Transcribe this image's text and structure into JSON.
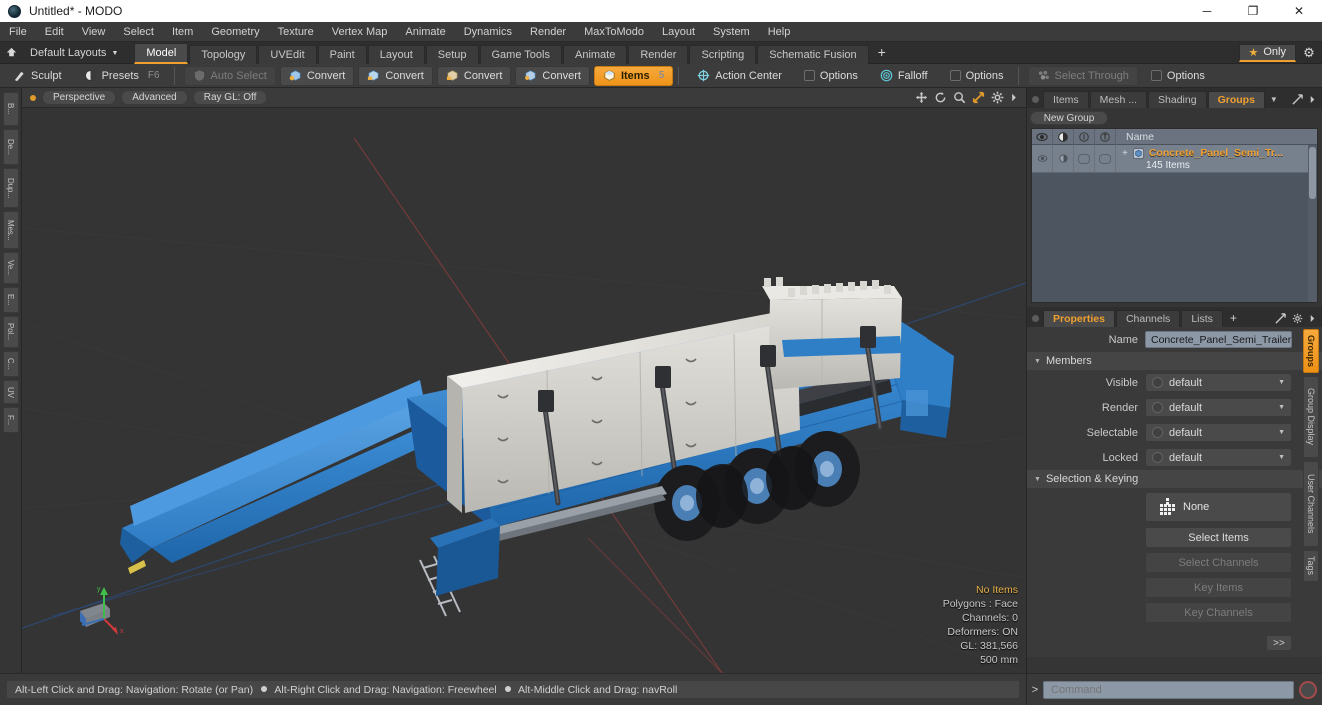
{
  "window": {
    "title": "Untitled* - MODO",
    "app_icon": "modo-sphere-icon",
    "minimize": "─",
    "maximize": "❐",
    "close": "✕"
  },
  "menubar": {
    "items": [
      "File",
      "Edit",
      "View",
      "Select",
      "Item",
      "Geometry",
      "Texture",
      "Vertex Map",
      "Animate",
      "Dynamics",
      "Render",
      "MaxToModo",
      "Layout",
      "System",
      "Help"
    ]
  },
  "layoutbar": {
    "home_icon": "home-layout-icon",
    "layout_selector": "Default Layouts",
    "caret": "▼",
    "tabs": [
      {
        "label": "Model",
        "active": true
      },
      {
        "label": "Topology",
        "active": false
      },
      {
        "label": "UVEdit",
        "active": false
      },
      {
        "label": "Paint",
        "active": false
      },
      {
        "label": "Layout",
        "active": false
      },
      {
        "label": "Setup",
        "active": false
      },
      {
        "label": "Game Tools",
        "active": false
      },
      {
        "label": "Animate",
        "active": false
      },
      {
        "label": "Render",
        "active": false
      },
      {
        "label": "Scripting",
        "active": false
      },
      {
        "label": "Schematic Fusion",
        "active": false
      }
    ],
    "add_tab": "+",
    "only_label": "Only",
    "only_star": "★",
    "gear": "⚙",
    "accent": "#f0a030"
  },
  "toolbar": {
    "items": [
      {
        "label": "Sculpt",
        "icon": "sculpt-brush-icon",
        "state": "flat"
      },
      {
        "label": "Presets",
        "icon": "presets-sphere-icon",
        "state": "flat",
        "shortcut": "F6"
      },
      {
        "label": "Auto Select",
        "icon": "auto-select-icon",
        "state": "disabled"
      },
      {
        "label": "Convert",
        "icon": "convert-vertex-icon",
        "state": "normal"
      },
      {
        "label": "Convert",
        "icon": "convert-edge-icon",
        "state": "normal"
      },
      {
        "label": "Convert",
        "icon": "convert-polygon-icon",
        "state": "normal"
      },
      {
        "label": "Convert",
        "icon": "convert-item-icon",
        "state": "normal"
      },
      {
        "label": "Items",
        "icon": "items-cube-icon",
        "state": "active",
        "shortcut": "5"
      },
      {
        "label": "Action Center",
        "icon": "action-center-icon",
        "state": "flat"
      },
      {
        "label": "Options",
        "icon": "checkbox-icon",
        "state": "flat"
      },
      {
        "label": "Falloff",
        "icon": "falloff-icon",
        "state": "flat"
      },
      {
        "label": "Options",
        "icon": "checkbox-icon",
        "state": "flat"
      },
      {
        "label": "Select Through",
        "icon": "select-through-icon",
        "state": "disabled"
      },
      {
        "label": "Options",
        "icon": "checkbox-icon",
        "state": "flat"
      }
    ]
  },
  "left_tabs": [
    "B...",
    "De...",
    "Dup...",
    "Mes...",
    "Ve...",
    "E...",
    "Pol...",
    "C...",
    "UV",
    "F..."
  ],
  "viewport": {
    "dot": "viewport-active-dot",
    "buttons": [
      "Perspective",
      "Advanced",
      "Ray GL: Off"
    ],
    "icons": [
      "move-icon",
      "rotate-icon",
      "zoom-icon",
      "fit-icon",
      "gear-icon",
      "chevron-right-icon"
    ],
    "stats": {
      "items": "No Items",
      "polygons": "Polygons : Face",
      "channels": "Channels: 0",
      "deformers": "Deformers: ON",
      "gl": "GL: 381,566",
      "scale": "500 mm"
    },
    "background": "#343434",
    "model_color": "#3d8fd8",
    "concrete_color": "#cfcfca"
  },
  "item_panel": {
    "dot": "panel-menu-dot",
    "tabs": [
      {
        "label": "Items",
        "active": false
      },
      {
        "label": "Mesh ...",
        "active": false
      },
      {
        "label": "Shading",
        "active": false
      },
      {
        "label": "Groups",
        "active": true
      }
    ],
    "tab_caret": "▼",
    "expand_icon": "expand-icon",
    "arrow_icon": "chevron-right-icon",
    "new_group_button": "New Group",
    "columns": [
      "eye-icon",
      "render-icon",
      "lock-icon",
      "info-icon",
      "Name"
    ],
    "name_header": "Name",
    "rows": [
      {
        "title": "Concrete_Panel_Semi_Tr...",
        "subtitle": "145 Items",
        "expander": "+",
        "icon": "group-item-icon"
      }
    ]
  },
  "properties": {
    "dot": "panel-menu-dot",
    "tabs": [
      {
        "label": "Properties",
        "active": true
      },
      {
        "label": "Channels",
        "active": false
      },
      {
        "label": "Lists",
        "active": false
      }
    ],
    "add_tab": "+",
    "expand_icon": "expand-icon",
    "gear_icon": "gear-icon",
    "arrow_icon": "chevron-right-icon",
    "name_label": "Name",
    "name_value": "Concrete_Panel_Semi_Trailer_Lo",
    "members_section": "Members",
    "fields": [
      {
        "label": "Visible",
        "value": "default"
      },
      {
        "label": "Render",
        "value": "default"
      },
      {
        "label": "Selectable",
        "value": "default"
      },
      {
        "label": "Locked",
        "value": "default"
      }
    ],
    "selection_section": "Selection & Keying",
    "none_value": "None",
    "none_icon": "dot-grid-icon",
    "buttons": [
      {
        "label": "Select Items",
        "enabled": true
      },
      {
        "label": "Select Channels",
        "enabled": false
      },
      {
        "label": "Key Items",
        "enabled": false
      },
      {
        "label": "Key Channels",
        "enabled": false
      }
    ],
    "more_button": ">>",
    "vtabs": [
      {
        "label": "Groups",
        "active": true
      },
      {
        "label": "Group Display",
        "active": false
      },
      {
        "label": "User Channels",
        "active": false
      },
      {
        "label": "Tags",
        "active": false
      }
    ]
  },
  "statusbar": {
    "hint_1": "Alt-Left Click and Drag: Navigation: Rotate (or Pan)",
    "hint_2": "Alt-Right Click and Drag: Navigation: Freewheel",
    "hint_3": "Alt-Middle Click and Drag: navRoll"
  },
  "command": {
    "prompt": ">",
    "placeholder": "Command",
    "record_icon": "record-icon"
  }
}
